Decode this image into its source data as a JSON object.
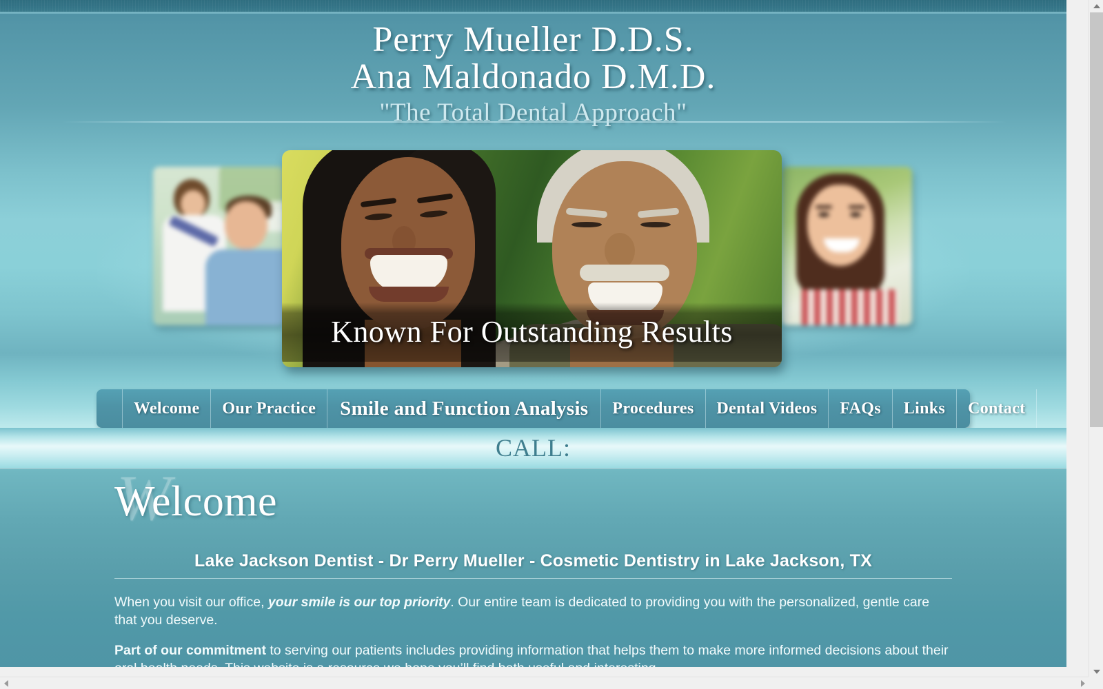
{
  "site": {
    "header": {
      "doctor_1": "Perry Mueller D.D.S.",
      "doctor_2": "Ana Maldonado D.M.D.",
      "tagline": "\"The Total Dental Approach\""
    },
    "hero": {
      "caption": "Known For Outstanding Results",
      "thumb_left_alt": "father-and-son-photo",
      "thumb_right_alt": "smiling-woman-photo",
      "main_alt": "laughing-couple-photo"
    },
    "nav": {
      "items": [
        {
          "label": "Welcome",
          "emphasis": false
        },
        {
          "label": "Our Practice",
          "emphasis": false
        },
        {
          "label": "Smile and Function Analysis",
          "emphasis": true
        },
        {
          "label": "Procedures",
          "emphasis": false
        },
        {
          "label": "Dental Videos",
          "emphasis": false
        },
        {
          "label": "FAQs",
          "emphasis": false
        },
        {
          "label": "Links",
          "emphasis": false
        },
        {
          "label": "Contact",
          "emphasis": false
        }
      ]
    },
    "call_band": {
      "text": "CALL:"
    },
    "page": {
      "title": "Welcome",
      "title_watermark": "W",
      "content_heading": "Lake Jackson Dentist - Dr Perry Mueller - Cosmetic Dentistry in Lake Jackson, TX",
      "paragraph_1": {
        "part_1": "When you visit our office, ",
        "emphasis": "your smile is our top priority",
        "part_2": ".  Our entire team is dedicated to providing you with the personalized, gentle care that you deserve."
      },
      "paragraph_2": {
        "bold": "Part of our commitment",
        "rest": " to serving our patients includes providing information that helps them to make more informed decisions about their oral health needs.  This website is a resource we hope you’ll find both useful and interesting."
      }
    },
    "colors": {
      "brand_teal": "#4d91a4",
      "nav_teal": "#4e93a6",
      "pale_aqua": "#8ccfd8",
      "call_text": "#3f7e8e",
      "top_strip": "#34748 7"
    }
  },
  "browser": {
    "vertical_scrollbar": "vertical-scrollbar",
    "horizontal_scrollbar": "horizontal-scrollbar"
  }
}
